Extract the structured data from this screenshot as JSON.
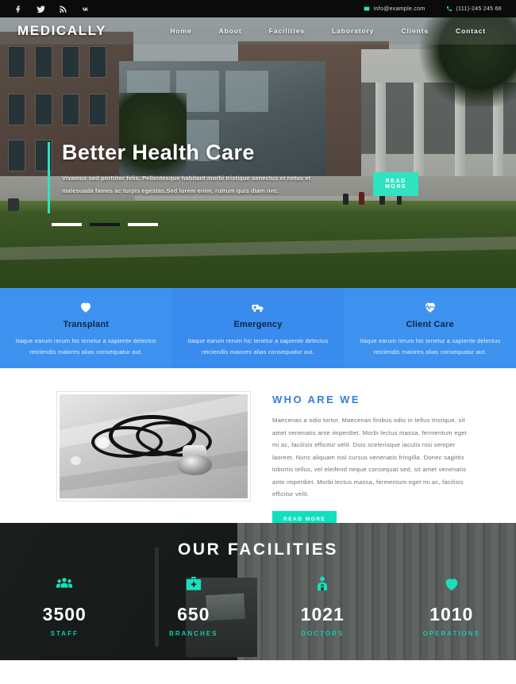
{
  "topbar": {
    "social": [
      {
        "name": "facebook-icon",
        "label": "Facebook"
      },
      {
        "name": "twitter-icon",
        "label": "Twitter"
      },
      {
        "name": "rss-icon",
        "label": "RSS"
      },
      {
        "name": "vk-icon",
        "label": "VK"
      }
    ],
    "email": "info@example.com",
    "phone": "(111)-245 245 66"
  },
  "header": {
    "logo": "MEDICALLY",
    "nav": [
      {
        "label": "Home"
      },
      {
        "label": "About"
      },
      {
        "label": "Facilities"
      },
      {
        "label": "Laboratory"
      },
      {
        "label": "Clients"
      },
      {
        "label": "Contact"
      }
    ]
  },
  "hero": {
    "title": "Better Health Care",
    "text": "Vivamus sed porttitor felis. Pellentesque habitant morbi tristique senectus et netus et malesuada fames ac turpis egestas.Sed lorem enim, rutrum quis diam nec.",
    "button": "READ MORE",
    "slides": 3,
    "active_slide": 2
  },
  "services": [
    {
      "icon": "heart-icon",
      "title": "Transplant",
      "text": "Itaque earum rerum hic tenetur a sapiente delectus reiciendis maiores alias consequatur aut."
    },
    {
      "icon": "ambulance-icon",
      "title": "Emergency",
      "text": "Itaque earum rerum hic tenetur a sapiente delectus reiciendis maiores alias consequatur aut."
    },
    {
      "icon": "heartbeat-icon",
      "title": "Client Care",
      "text": "Itaque earum rerum hic tenetur a sapiente delectus reiciendis maiores alias consequatur aut."
    }
  ],
  "about": {
    "image_alt": "stethoscope-photo",
    "title": "WHO ARE WE",
    "text": "Maecenas a odio tortor. Maecenas finibus odio in tellus tristique, sit amet venenatis ante imperdiet. Morbi lectus massa, fermentum eget mi ac, facilisis efficitur velit. Duis scelerisque iaculis nisi semper laoreet. Nunc aliquam nisl cursus venenatis fringilla. Donec sagittis lobortis tellus, vel eleifend neque consequat sed, sit amet venenatis ante imperdiet. Morbi lectus massa, fermentum eget mi ac, facilisis efficitur velit.",
    "button": "READ MORE"
  },
  "facilities": {
    "title": "OUR FACILITIES",
    "counters": [
      {
        "icon": "users-icon",
        "value": "3500",
        "label": "STAFF"
      },
      {
        "icon": "medkit-icon",
        "value": "650",
        "label": "BRANCHES"
      },
      {
        "icon": "doctor-icon",
        "value": "1021",
        "label": "DOCTORS"
      },
      {
        "icon": "heart-icon",
        "value": "1010",
        "label": "OPERATIONS"
      }
    ]
  },
  "colors": {
    "topbar_bg": "#0b0b0b",
    "teal": "#2fe3c0",
    "blue": "#3d92f0",
    "about_title": "#2f7fe0",
    "counter_teal": "#18e0bb"
  }
}
